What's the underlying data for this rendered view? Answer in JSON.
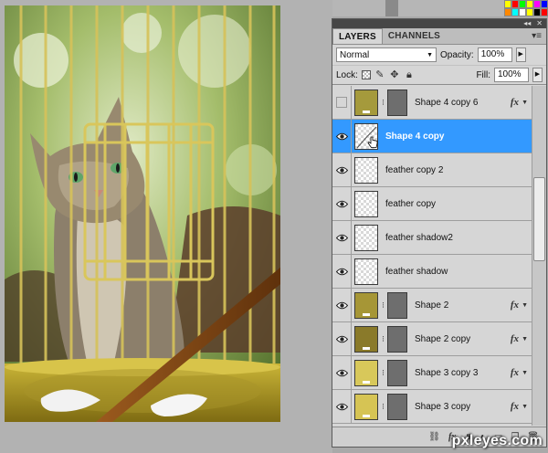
{
  "panel": {
    "tabs": [
      {
        "label": "LAYERS",
        "active": true
      },
      {
        "label": "CHANNELS",
        "active": false
      }
    ],
    "blend_mode": "Normal",
    "opacity_label": "Opacity:",
    "opacity_value": "100%",
    "lock_label": "Lock:",
    "fill_label": "Fill:",
    "fill_value": "100%"
  },
  "layers": [
    {
      "name": "Shape 4 copy 6",
      "visible": false,
      "thumb": "shape",
      "thumb_color": "#a59a3c",
      "mask": true,
      "fx": true,
      "selected": false
    },
    {
      "name": "Shape 4 copy",
      "visible": true,
      "thumb": "checker",
      "mask": false,
      "fx": false,
      "selected": true
    },
    {
      "name": "feather copy 2",
      "visible": true,
      "thumb": "checker",
      "mask": false,
      "fx": false,
      "selected": false
    },
    {
      "name": "feather copy",
      "visible": true,
      "thumb": "checker",
      "mask": false,
      "fx": false,
      "selected": false
    },
    {
      "name": "feather shadow2",
      "visible": true,
      "thumb": "checker",
      "mask": false,
      "fx": false,
      "selected": false
    },
    {
      "name": "feather shadow",
      "visible": true,
      "thumb": "checker",
      "mask": false,
      "fx": false,
      "selected": false
    },
    {
      "name": "Shape 2",
      "visible": true,
      "thumb": "shape",
      "thumb_color": "#a69636",
      "mask": true,
      "fx": true,
      "selected": false
    },
    {
      "name": "Shape 2 copy",
      "visible": true,
      "thumb": "shape",
      "thumb_color": "#8a7a2a",
      "mask": true,
      "fx": true,
      "selected": false
    },
    {
      "name": "Shape 3 copy 3",
      "visible": true,
      "thumb": "shape",
      "thumb_color": "#d8c85a",
      "mask": true,
      "fx": true,
      "selected": false
    },
    {
      "name": "Shape 3 copy",
      "visible": true,
      "thumb": "shape",
      "thumb_color": "#d6c454",
      "mask": true,
      "fx": true,
      "selected": false
    }
  ],
  "fx_label": "fx",
  "bottom_bar": {
    "fx_label": "fx."
  },
  "icons": {
    "panel_collapse": "double-chevron-icon",
    "panel_close": "close-icon",
    "panel_menu": "panel-menu-icon",
    "visibility": "eye-icon",
    "link": "chain-link-icon",
    "pointer": "hand-pointer-icon"
  },
  "watermark": "pxleyes.com",
  "colors": {
    "selected_row": "#3399ff",
    "panel_bg": "#d6d6d6"
  }
}
